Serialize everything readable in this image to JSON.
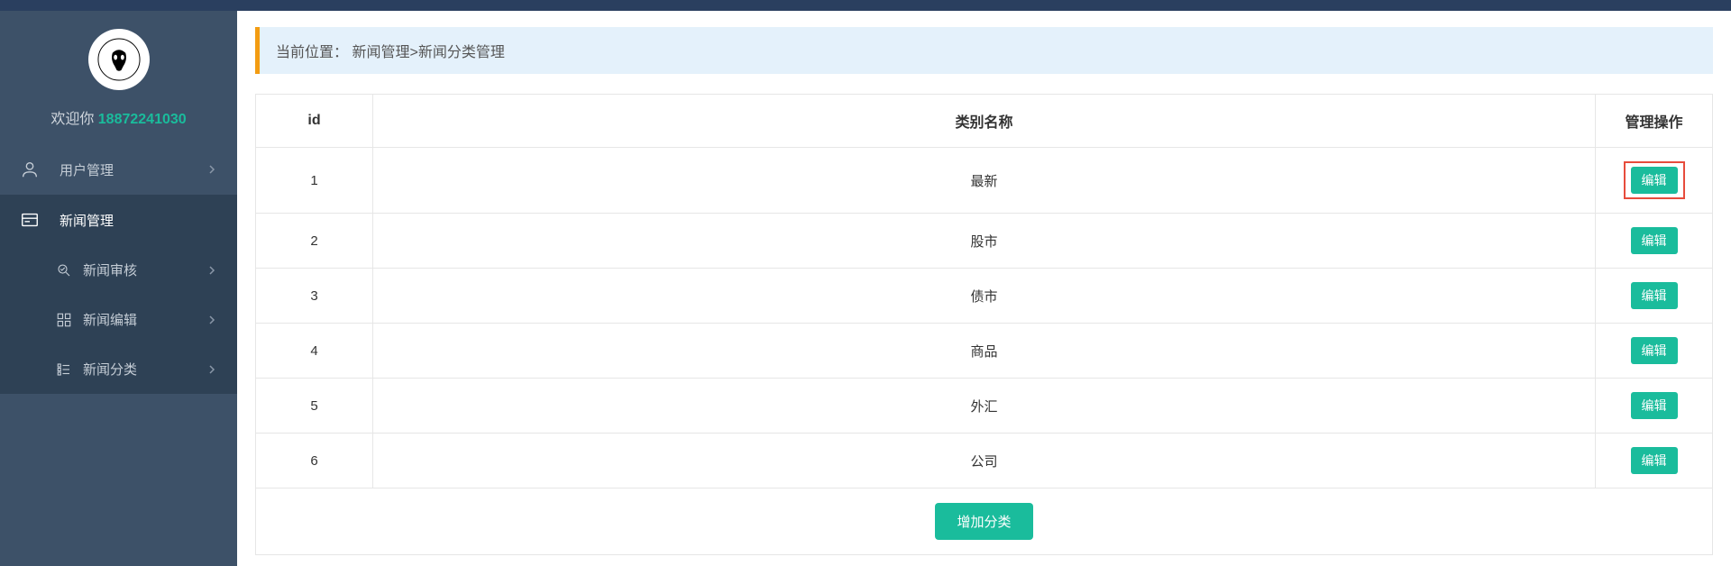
{
  "sidebar": {
    "welcome_prefix": "欢迎你 ",
    "username": "18872241030",
    "menu": [
      {
        "label": "用户管理"
      },
      {
        "label": "新闻管理"
      }
    ],
    "submenu": [
      {
        "label": "新闻审核"
      },
      {
        "label": "新闻编辑"
      },
      {
        "label": "新闻分类"
      }
    ]
  },
  "breadcrumb": {
    "prefix": "当前位置：",
    "path": "新闻管理>新闻分类管理"
  },
  "table": {
    "headers": {
      "id": "id",
      "name": "类别名称",
      "action": "管理操作"
    },
    "rows": [
      {
        "id": "1",
        "name": "最新"
      },
      {
        "id": "2",
        "name": "股市"
      },
      {
        "id": "3",
        "name": "债市"
      },
      {
        "id": "4",
        "name": "商品"
      },
      {
        "id": "5",
        "name": "外汇"
      },
      {
        "id": "6",
        "name": "公司"
      }
    ],
    "edit_label": "编辑",
    "add_label": "增加分类"
  }
}
